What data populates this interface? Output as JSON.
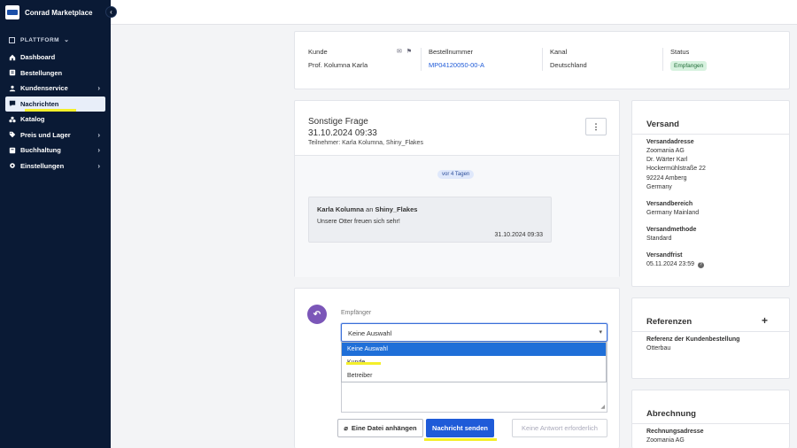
{
  "app": {
    "title": "Conrad Marketplace"
  },
  "sidebar": {
    "section": "PLATTFORM",
    "items": [
      {
        "label": "Dashboard",
        "icon": "home-icon",
        "has_arrow": false
      },
      {
        "label": "Bestellungen",
        "icon": "orders-icon",
        "has_arrow": false
      },
      {
        "label": "Kundenservice",
        "icon": "person-icon",
        "has_arrow": true
      },
      {
        "label": "Nachrichten",
        "icon": "message-icon",
        "has_arrow": false,
        "active": true
      },
      {
        "label": "Katalog",
        "icon": "catalog-icon",
        "has_arrow": false
      },
      {
        "label": "Preis und Lager",
        "icon": "tag-icon",
        "has_arrow": true
      },
      {
        "label": "Buchhaltung",
        "icon": "ledger-icon",
        "has_arrow": true
      },
      {
        "label": "Einstellungen",
        "icon": "gear-icon",
        "has_arrow": true
      }
    ]
  },
  "order": {
    "customer_label": "Kunde",
    "customer_name": "Prof. Kolumna Karla",
    "order_number_label": "Bestellnummer",
    "order_number": "MP04120050-00-A",
    "channel_label": "Kanal",
    "channel": "Deutschland",
    "status_label": "Status",
    "status": "Empfangen"
  },
  "thread": {
    "subject": "Sonstige Frage",
    "date": "31.10.2024 09:33",
    "participants": "Teilnehmer: Karla Kolumna, Shiny_Flakes",
    "age_pill": "vor 4 Tagen",
    "message": {
      "from": "Karla Kolumna",
      "connector": "an",
      "to": "Shiny_Flakes",
      "text": "Unsere Otter freuen sich sehr!",
      "time": "31.10.2024 09:33"
    }
  },
  "reply": {
    "recipient_label": "Empfänger",
    "selected": "Keine Auswahl",
    "options": [
      "Keine Auswahl",
      "Kunde",
      "Betreiber"
    ],
    "attach_label": "Eine Datei anhängen",
    "send_label": "Nachricht senden",
    "no_reply_label": "Keine Antwort erforderlich"
  },
  "shipping": {
    "title": "Versand",
    "address_label": "Versandadresse",
    "address_lines": [
      "Zoomania AG",
      "Dr. Wärter Karl",
      "Hockermühlstraße 22",
      "92224 Amberg",
      "Germany"
    ],
    "area_label": "Versandbereich",
    "area": "Germany Mainland",
    "method_label": "Versandmethode",
    "method": "Standard",
    "deadline_label": "Versandfrist",
    "deadline": "05.11.2024 23:59"
  },
  "references": {
    "title": "Referenzen",
    "ref_label": "Referenz der Kundenbestellung",
    "ref_value": "Otterbau"
  },
  "billing": {
    "title": "Abrechnung",
    "address_label": "Rechnungsadresse",
    "address_line": "Zoomania AG"
  },
  "colors": {
    "sidebar_bg": "#0a1a35",
    "primary": "#1f5bd8",
    "highlight": "#f4ef2a",
    "status_green": "#d7f2df",
    "reply_icon": "#7b56b8"
  }
}
